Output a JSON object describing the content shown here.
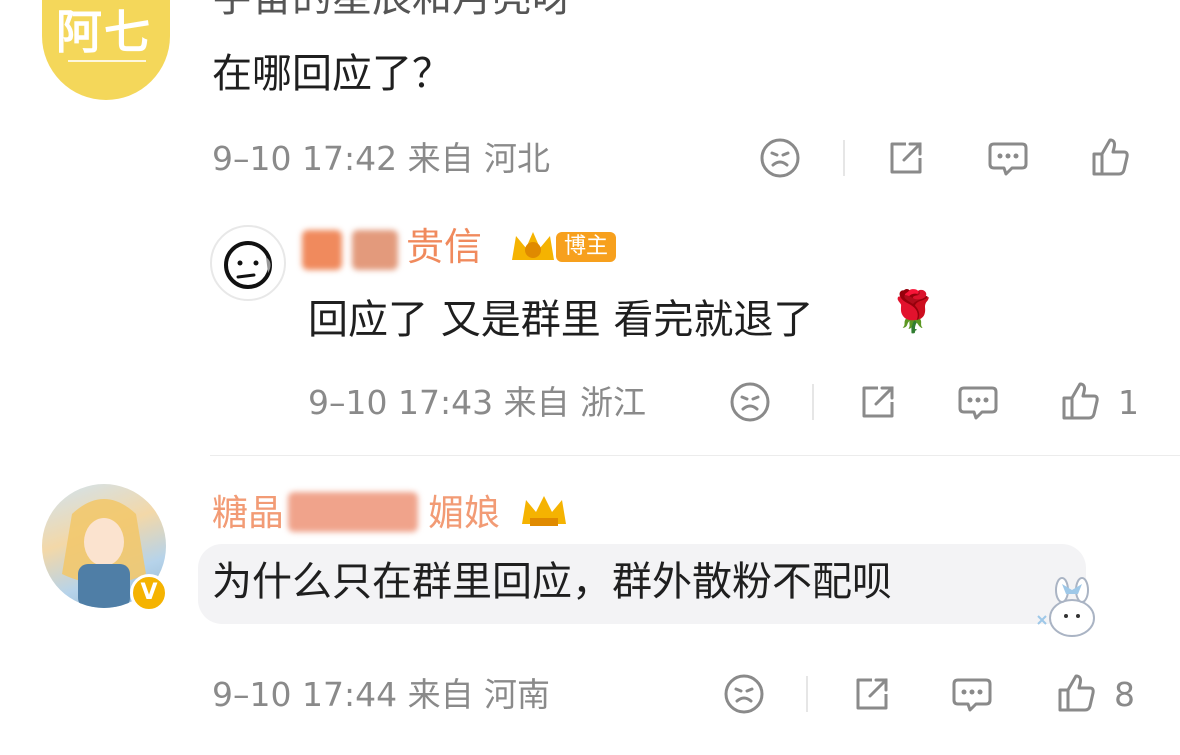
{
  "comments": [
    {
      "truncated_top_text": "宇宙的星辰和月亮呀",
      "avatar_text": "阿七",
      "text": "在哪回应了？",
      "meta": "9–10 17:42 来自 河北",
      "likes": ""
    },
    {
      "username_partial": "贵信",
      "badge": "博主",
      "text": "回应了 又是群里 看完就退了",
      "emoji": "🌹",
      "meta": "9–10 17:43 来自 浙江",
      "likes": "1"
    },
    {
      "username_partial": "糖晶",
      "username_partial_2": "媚娘",
      "verified": "V",
      "text": "为什么只在群里回应，群外散粉不配呗",
      "meta": "9–10 17:44 来自 河南",
      "likes": "8"
    }
  ],
  "colors": {
    "meta_gray": "#8a8a8a",
    "badge_orange": "#f7a01d",
    "verified_gold": "#f5b301",
    "avatar_yellow": "#f4d75a"
  },
  "icons": [
    "dislike-face-icon",
    "share-icon",
    "comment-icon",
    "like-thumb-icon"
  ]
}
